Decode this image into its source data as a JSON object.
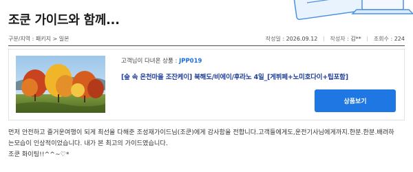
{
  "page": {
    "title": "조쿤 가이드와 함께..."
  },
  "breadcrumb": {
    "text": "구분/지역 : 패키지 > 일본"
  },
  "stats": {
    "date_label": "작성일 :",
    "date_value": "2026.09.12",
    "author_label": "작성자 :",
    "author_value": "김**",
    "views_label": "조회수 :",
    "views_value": "224"
  },
  "product": {
    "code_prefix": "고객님이 다녀온 상품 : ",
    "code": "JPP019",
    "name": "[숲 속 온천마을 조잔케이] 북해도/비에이/후라노 4일_[게뷔페+노미호다이+팁포함]",
    "button_label": "상품보기",
    "thumbnail": "autumn-foliage-park-photo"
  },
  "review": {
    "lines": [
      "먼저 안전하고 즐거운여행이 되게 최선을 다해준 조성재가이드님(조쿤)에게  감사함을 전합니다.고객들에게도,운전기사님에게까지.한분.한분.배려하",
      "는모습이 인상적이었습니다. 내가 본 최고의  가이드였습니다.",
      "조쿤 화이팅!!^^~♡*"
    ]
  }
}
